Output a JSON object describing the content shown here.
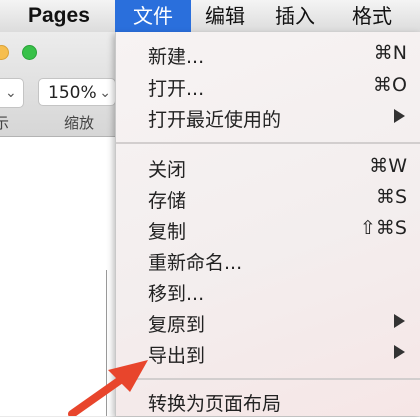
{
  "menubar": {
    "app": "Pages",
    "file": "文件",
    "edit": "编辑",
    "insert": "插入",
    "format": "格式"
  },
  "toolbar": {
    "view_chevron": "⌄",
    "zoom_value": "150%",
    "zoom_chevron": "⌄",
    "view_label": "示",
    "zoom_label": "缩放"
  },
  "menu": {
    "items": [
      {
        "label": "新建...",
        "shortcut": "⌘N"
      },
      {
        "label": "打开...",
        "shortcut": "⌘O"
      },
      {
        "label": "打开最近使用的",
        "submenu": true
      },
      {
        "label": "关闭",
        "shortcut": "⌘W"
      },
      {
        "label": "存储",
        "shortcut": "⌘S"
      },
      {
        "label": "复制",
        "shortcut": "⇧⌘S"
      },
      {
        "label": "重新命名..."
      },
      {
        "label": "移到..."
      },
      {
        "label": "复原到",
        "submenu": true
      },
      {
        "label": "导出到",
        "submenu": true
      },
      {
        "label": "转换为页面布局"
      }
    ]
  },
  "colors": {
    "highlight": "#2a6fdc",
    "annotation_arrow": "#e8452c"
  }
}
